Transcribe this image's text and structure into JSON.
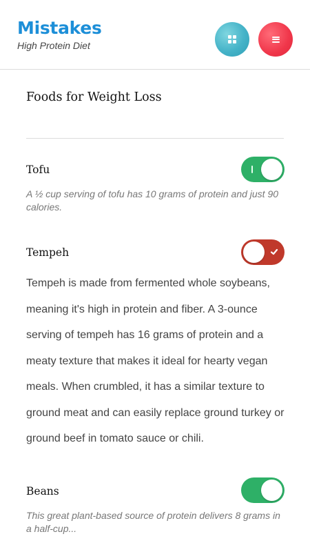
{
  "header": {
    "title": "Mistakes",
    "subtitle": "High Protein Diet",
    "grid_button_icon": "grid-icon",
    "menu_button_icon": "hamburger-menu-icon"
  },
  "section": {
    "title": "Foods for Weight Loss"
  },
  "items": [
    {
      "name": "Tofu",
      "toggle_state": "on",
      "description": "A ½ cup serving of tofu has 10 grams of protein and just 90 calories."
    },
    {
      "name": "Tempeh",
      "toggle_state": "off",
      "description": "Tempeh is made from fermented whole soybeans, meaning it's high in protein and fiber. A 3-ounce serving of tempeh has 16 grams of protein and a meaty texture that makes it ideal for hearty vegan meals. When crumbled, it has a similar texture to ground meat and can easily replace ground turkey or ground beef in tomato sauce or chili."
    },
    {
      "name": "Beans",
      "toggle_state": "on",
      "description": "This great plant-based source of protein delivers 8 grams in a half-cup..."
    }
  ],
  "colors": {
    "brand": "#1d8fd8",
    "toggle_on": "#2eb067",
    "toggle_off": "#c0392b",
    "grid_button": "#45b3c8",
    "menu_button": "#f0364a"
  }
}
